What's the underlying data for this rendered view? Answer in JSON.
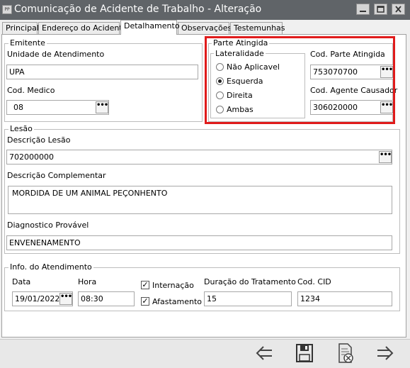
{
  "window": {
    "app_icon": "PP",
    "title": "Comunicação de Acidente de Trabalho - Alteração",
    "controls": [
      "minimize-icon",
      "maximize-icon",
      "close-icon"
    ]
  },
  "tabs": [
    {
      "label": "Principal",
      "active": false
    },
    {
      "label": "Endereço do Acidente",
      "active": false
    },
    {
      "label": "Detalhamento",
      "active": true
    },
    {
      "label": "Observações",
      "active": false
    },
    {
      "label": "Testemunhas",
      "active": false
    }
  ],
  "emitente": {
    "legend": "Emitente",
    "unidade_label": "Unidade de Atendimento",
    "unidade_value": "UPA",
    "medico_label": "Cod. Medico",
    "medico_value": "08"
  },
  "parte_atingida": {
    "legend": "Parte Atingida",
    "lateralidade_legend": "Lateralidade",
    "options": [
      {
        "label": "Não Aplicavel",
        "selected": false
      },
      {
        "label": "Esquerda",
        "selected": true
      },
      {
        "label": "Direita",
        "selected": false
      },
      {
        "label": "Ambas",
        "selected": false
      }
    ],
    "cod_parte_label": "Cod. Parte Atingida",
    "cod_parte_value": "753070700",
    "cod_agente_label": "Cod. Agente Causador",
    "cod_agente_value": "306020000",
    "highlight_color": "#e01b1b"
  },
  "lesao": {
    "legend": "Lesão",
    "descricao_label": "Descrição Lesão",
    "descricao_value": "702000000",
    "complementar_label": "Descrição Complementar",
    "complementar_value": "MORDIDA DE UM ANIMAL PEÇONHENTO",
    "diagnostico_label": "Diagnostico Provável",
    "diagnostico_value": "ENVENENAMENTO"
  },
  "atendimento": {
    "legend": "Info. do Atendimento",
    "data_label": "Data",
    "data_value": "19/01/2022",
    "hora_label": "Hora",
    "hora_value": "08:30",
    "internacao_label": "Internação",
    "internacao_checked": true,
    "afastamento_label": "Afastamento",
    "afastamento_checked": true,
    "duracao_label": "Duração do Tratamento",
    "duracao_value": "15",
    "cid_label": "Cod. CID",
    "cid_value": "1234"
  },
  "lookup_button_label": "•••",
  "checkmark": "✓",
  "toolbar": [
    "arrow-left-icon",
    "save-icon",
    "cancel-document-icon",
    "arrow-right-icon"
  ]
}
